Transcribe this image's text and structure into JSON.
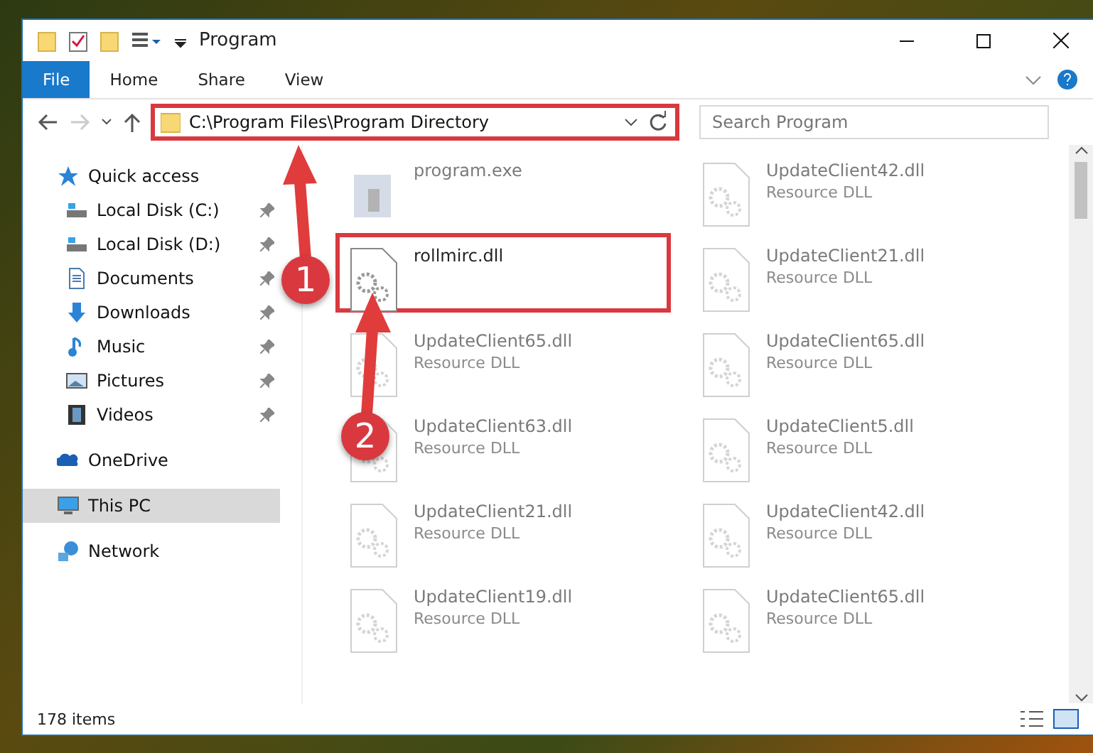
{
  "window": {
    "title": "Program"
  },
  "ribbon_tabs": [
    {
      "label": "File",
      "selected": true
    },
    {
      "label": "Home",
      "selected": false
    },
    {
      "label": "Share",
      "selected": false
    },
    {
      "label": "View",
      "selected": false
    }
  ],
  "address": {
    "path": "C:\\Program Files\\Program Directory",
    "highlighted": true
  },
  "search": {
    "placeholder": "Search Program"
  },
  "sidebar": {
    "items": [
      {
        "label": "Quick access",
        "kind": "star",
        "pinned": false,
        "selected": false,
        "child": false
      },
      {
        "label": "Local Disk (C:)",
        "kind": "disk",
        "pinned": true,
        "selected": false,
        "child": true
      },
      {
        "label": "Local Disk (D:)",
        "kind": "disk",
        "pinned": true,
        "selected": false,
        "child": true
      },
      {
        "label": "Documents",
        "kind": "doc",
        "pinned": true,
        "selected": false,
        "child": true
      },
      {
        "label": "Downloads",
        "kind": "download",
        "pinned": true,
        "selected": false,
        "child": true
      },
      {
        "label": "Music",
        "kind": "music",
        "pinned": true,
        "selected": false,
        "child": true
      },
      {
        "label": "Pictures",
        "kind": "picture",
        "pinned": true,
        "selected": false,
        "child": true
      },
      {
        "label": "Videos",
        "kind": "video",
        "pinned": true,
        "selected": false,
        "child": true
      },
      {
        "label": "OneDrive",
        "kind": "cloud",
        "pinned": false,
        "selected": false,
        "child": false
      },
      {
        "label": "This PC",
        "kind": "pc",
        "pinned": false,
        "selected": true,
        "child": false
      },
      {
        "label": "Network",
        "kind": "network",
        "pinned": false,
        "selected": false,
        "child": false
      }
    ]
  },
  "files": [
    {
      "name": "program.exe",
      "kind": "exe",
      "faded": true,
      "highlighted": false
    },
    {
      "name": "UpdateClient42.dll",
      "type": "Resource DLL",
      "kind": "dll",
      "faded": true,
      "highlighted": false
    },
    {
      "name": "rollmirc.dll",
      "kind": "dll",
      "faded": false,
      "highlighted": true
    },
    {
      "name": "UpdateClient21.dll",
      "type": "Resource DLL",
      "kind": "dll",
      "faded": true,
      "highlighted": false
    },
    {
      "name": "UpdateClient65.dll",
      "type": "Resource DLL",
      "kind": "dll",
      "faded": true,
      "highlighted": false
    },
    {
      "name": "UpdateClient65.dll",
      "type": "Resource DLL",
      "kind": "dll",
      "faded": true,
      "highlighted": false
    },
    {
      "name": "UpdateClient63.dll",
      "type": "Resource DLL",
      "kind": "dll",
      "faded": true,
      "highlighted": false
    },
    {
      "name": "UpdateClient5.dll",
      "type": "Resource DLL",
      "kind": "dll",
      "faded": true,
      "highlighted": false
    },
    {
      "name": "UpdateClient21.dll",
      "type": "Resource DLL",
      "kind": "dll",
      "faded": true,
      "highlighted": false
    },
    {
      "name": "UpdateClient42.dll",
      "type": "Resource DLL",
      "kind": "dll",
      "faded": true,
      "highlighted": false
    },
    {
      "name": "UpdateClient19.dll",
      "type": "Resource DLL",
      "kind": "dll",
      "faded": true,
      "highlighted": false
    },
    {
      "name": "UpdateClient65.dll",
      "type": "Resource DLL",
      "kind": "dll",
      "faded": true,
      "highlighted": false
    }
  ],
  "annotations": [
    {
      "number": "1"
    },
    {
      "number": "2"
    }
  ],
  "status_bar": {
    "count": "178 items"
  }
}
